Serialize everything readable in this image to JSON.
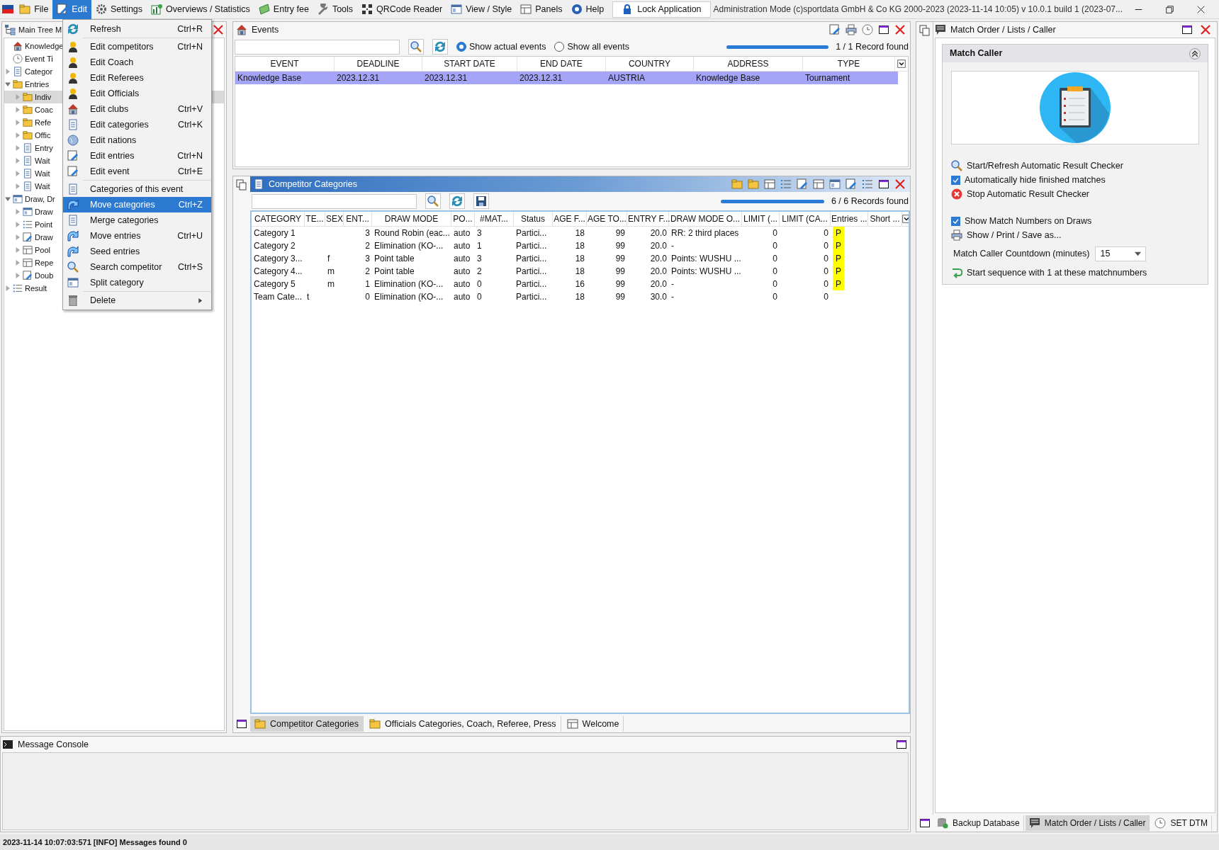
{
  "menu_bar": {
    "items": [
      {
        "label": "File",
        "selected": false
      },
      {
        "label": "Edit",
        "selected": true
      },
      {
        "label": "Settings",
        "selected": false
      },
      {
        "label": "Overviews / Statistics",
        "selected": false
      },
      {
        "label": "Entry fee",
        "selected": false
      },
      {
        "label": "Tools",
        "selected": false
      },
      {
        "label": "QRCode Reader",
        "selected": false
      },
      {
        "label": "View / Style",
        "selected": false
      },
      {
        "label": "Panels",
        "selected": false
      },
      {
        "label": "Help",
        "selected": false
      }
    ],
    "lock_button": "Lock Application",
    "title": "Administration Mode (c)sportdata GmbH & Co KG 2000-2023 (2023-11-14 10:05)  v 10.0.1 build 1 (2023-07..."
  },
  "edit_menu": {
    "groups": [
      [
        {
          "label": "Refresh",
          "shortcut": "Ctrl+R",
          "selected": false
        }
      ],
      [
        {
          "label": "Edit competitors",
          "shortcut": "Ctrl+N",
          "selected": false
        },
        {
          "label": "Edit Coach",
          "selected": false
        },
        {
          "label": "Edit Referees",
          "selected": false
        },
        {
          "label": "Edit Officials",
          "selected": false
        },
        {
          "label": "Edit clubs",
          "shortcut": "Ctrl+V",
          "selected": false
        },
        {
          "label": "Edit categories",
          "shortcut": "Ctrl+K",
          "selected": false
        },
        {
          "label": "Edit nations",
          "selected": false
        },
        {
          "label": "Edit entries",
          "shortcut": "Ctrl+N",
          "selected": false
        },
        {
          "label": "Edit event",
          "shortcut": "Ctrl+E",
          "selected": false
        }
      ],
      [
        {
          "label": "Categories of this event",
          "selected": false
        },
        {
          "label": "Move categories",
          "shortcut": "Ctrl+Z",
          "selected": true
        },
        {
          "label": "Merge categories",
          "selected": false
        },
        {
          "label": "Move entries",
          "shortcut": "Ctrl+U",
          "selected": false
        },
        {
          "label": "Seed entries",
          "selected": false
        },
        {
          "label": "Search competitor",
          "shortcut": "Ctrl+S",
          "selected": false
        },
        {
          "label": "Split category",
          "selected": false
        }
      ],
      [
        {
          "label": "Delete",
          "submenu": true,
          "selected": false
        }
      ]
    ]
  },
  "tree_panel": {
    "title": "Main Tree M",
    "items": [
      {
        "label": "Knowledge",
        "selected": false
      },
      {
        "label": "Event Ti",
        "selected": false
      },
      {
        "label": "Categor",
        "expanded": false,
        "selected": false
      },
      {
        "label": "Entries",
        "expanded": true,
        "selected": false,
        "children": [
          {
            "label": "Indiv",
            "expanded": false,
            "selected": true
          },
          {
            "label": "Coac",
            "expanded": false,
            "selected": false
          },
          {
            "label": "Refe",
            "expanded": false,
            "selected": false
          },
          {
            "label": "Offic",
            "expanded": false,
            "selected": false
          },
          {
            "label": "Entry",
            "expanded": false,
            "selected": false
          },
          {
            "label": "Wait",
            "expanded": false,
            "selected": false
          },
          {
            "label": "Wait",
            "expanded": false,
            "selected": false
          },
          {
            "label": "Wait",
            "expanded": false,
            "selected": false
          }
        ]
      },
      {
        "label": "Draw, Dr",
        "expanded": true,
        "selected": false,
        "children": [
          {
            "label": "Draw",
            "expanded": false,
            "selected": false
          },
          {
            "label": "Point",
            "expanded": false,
            "selected": false
          },
          {
            "label": "Draw",
            "expanded": false,
            "selected": false
          },
          {
            "label": "Pool",
            "expanded": false,
            "selected": false
          },
          {
            "label": "Repe",
            "expanded": false,
            "selected": false
          },
          {
            "label": "Doub",
            "expanded": false,
            "selected": false
          }
        ]
      },
      {
        "label": "Result",
        "expanded": false,
        "selected": false
      }
    ]
  },
  "events_panel": {
    "title": "Events",
    "radios": [
      {
        "label": "Show actual events",
        "selected": true
      },
      {
        "label": "Show all events",
        "selected": false
      }
    ],
    "progress": {
      "level": 1
    },
    "record_count": "1 / 1 Record found",
    "table": {
      "columns": [
        "EVENT",
        "DEADLINE",
        "START DATE",
        "END DATE",
        "COUNTRY",
        "ADDRESS",
        "TYPE"
      ],
      "rows": [
        {
          "selected": true,
          "cells": [
            "Knowledge Base",
            "2023.12.31",
            "2023.12.31",
            "2023.12.31",
            "AUSTRIA",
            "Knowledge Base",
            "Tournament"
          ]
        }
      ]
    }
  },
  "categories_panel": {
    "title": "Competitor Categories",
    "progress": {
      "level": 1
    },
    "record_count": "6 / 6 Records found",
    "table": {
      "columns": [
        "CATEGORY",
        "TE...",
        "SEX",
        "ENT...",
        "DRAW MODE",
        "PO...",
        "#MAT...",
        "Status",
        "AGE F...",
        "AGE TO...",
        "ENTRY F...",
        "DRAW MODE O...",
        "LIMIT (...",
        "LIMIT (CA...",
        "Entries ...",
        "Short ..."
      ],
      "rows": [
        {
          "cells": [
            "Category 1",
            "",
            "",
            "3",
            "Round Robin (eac...",
            "auto",
            "3",
            "Partici...",
            "18",
            "99",
            "20.0",
            "RR: 2 third places",
            "0",
            "0",
            "P",
            ""
          ]
        },
        {
          "cells": [
            "Category 2",
            "",
            "",
            "2",
            "Elimination (KO-...",
            "auto",
            "1",
            "Partici...",
            "18",
            "99",
            "20.0",
            "-",
            "0",
            "0",
            "P",
            ""
          ]
        },
        {
          "cells": [
            "Category 3...",
            "",
            "f",
            "3",
            "Point table",
            "auto",
            "3",
            "Partici...",
            "18",
            "99",
            "20.0",
            "Points: WUSHU ...",
            "0",
            "0",
            "P",
            ""
          ]
        },
        {
          "cells": [
            "Category 4...",
            "",
            "m",
            "2",
            "Point table",
            "auto",
            "2",
            "Partici...",
            "18",
            "99",
            "20.0",
            "Points: WUSHU ...",
            "0",
            "0",
            "P",
            ""
          ]
        },
        {
          "cells": [
            "Category 5",
            "",
            "m",
            "1",
            "Elimination (KO-...",
            "auto",
            "0",
            "Partici...",
            "16",
            "99",
            "20.0",
            "-",
            "0",
            "0",
            "P",
            ""
          ]
        },
        {
          "cells": [
            "Team Cate...",
            "t",
            "",
            "0",
            "Elimination (KO-...",
            "auto",
            "0",
            "Partici...",
            "18",
            "99",
            "30.0",
            "-",
            "0",
            "0",
            "",
            ""
          ]
        }
      ]
    },
    "tabs": [
      {
        "label": "Competitor Categories",
        "selected": true
      },
      {
        "label": "Officials Categories, Coach, Referee, Press",
        "selected": false
      },
      {
        "label": "Welcome",
        "selected": false
      }
    ]
  },
  "console": {
    "title": "Message Console"
  },
  "right_panel": {
    "title": "Match Order / Lists / Caller",
    "section": "Match Caller",
    "actions": [
      {
        "kind": "search",
        "label": "Start/Refresh Automatic Result Checker"
      },
      {
        "kind": "checkbox",
        "label": "Automatically hide finished matches",
        "checked": true
      },
      {
        "kind": "stop",
        "label": "Stop Automatic Result Checker"
      },
      {
        "kind": "gap"
      },
      {
        "kind": "checkbox",
        "label": "Show Match Numbers on Draws",
        "checked": true
      },
      {
        "kind": "print",
        "label": "Show / Print / Save as..."
      }
    ],
    "countdown": {
      "label": "Match Caller Countdown (minutes)",
      "value": "15"
    },
    "sequence": "Start sequence with 1 at these matchnumbers",
    "tabs": [
      {
        "label": "Backup Database",
        "selected": false
      },
      {
        "label": "Match Order / Lists / Caller",
        "selected": true
      },
      {
        "label": "SET DTM",
        "selected": false
      }
    ]
  },
  "status_bar": "2023-11-14 10:07:03:571 [INFO] Messages found 0"
}
